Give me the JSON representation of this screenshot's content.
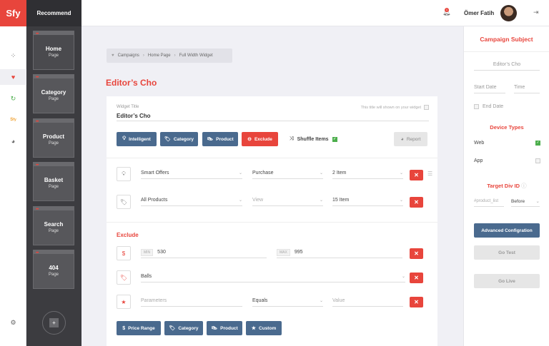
{
  "logo": "Sfy",
  "rail": {
    "icons": [
      "grid-icon",
      "heart-icon",
      "refresh-icon",
      "sfy-icon",
      "pie-icon",
      "gear-icon"
    ]
  },
  "pages": {
    "header": "Recommend",
    "items": [
      {
        "name": "Home",
        "sub": "Page"
      },
      {
        "name": "Category",
        "sub": "Page"
      },
      {
        "name": "Product",
        "sub": "Page"
      },
      {
        "name": "Basket",
        "sub": "Page"
      },
      {
        "name": "Search",
        "sub": "Page"
      },
      {
        "name": "404",
        "sub": "Page"
      }
    ],
    "add_label": "+"
  },
  "topbar": {
    "notification_count": "1",
    "user_name": "Ömer Fatih"
  },
  "breadcrumb": [
    "Campaigns",
    "Home Page",
    "Full Width Widget"
  ],
  "page_title": "Editor’s Cho",
  "widget": {
    "title_label": "Widget Title",
    "title_hint": "This title will shown on your widget",
    "title_value": "Editor’s Cho",
    "type_buttons": [
      "Intelligent",
      "Category",
      "Product",
      "Exclude"
    ],
    "shuffle_label": "Shuffle Items",
    "report_label": "Report",
    "rules": [
      {
        "source": "Smart Offers",
        "action": "Purchase",
        "count": "2 Item"
      },
      {
        "source": "All Products",
        "action": "View",
        "count": "15 Item"
      }
    ]
  },
  "exclude": {
    "title": "Exclude",
    "price": {
      "min_tag": "MIN",
      "min": "530",
      "max_tag": "MAX",
      "max": "995"
    },
    "category": "Balls",
    "param": {
      "placeholder": "Parameters",
      "operator": "Equals",
      "value_placeholder": "Value"
    },
    "buttons": [
      "Price Range",
      "Category",
      "Product",
      "Custom"
    ]
  },
  "right_panel": {
    "title": "Campaign Subject",
    "subject_value": "Editor’s Cho",
    "start_date": "Start Date",
    "time": "Time",
    "end_date": "End Date",
    "device_title": "Device Types",
    "devices": [
      {
        "label": "Web",
        "checked": true
      },
      {
        "label": "App",
        "checked": false
      }
    ],
    "target_title": "Target Div ID",
    "target_placeholder": "#product_list",
    "position": "Before",
    "advanced_button": "Advanced Configration",
    "test_button": "Go Test",
    "live_button": "Go Live"
  },
  "colors": {
    "accent": "#e8453c",
    "primary": "#4a6a8e",
    "success": "#4cae4c"
  }
}
